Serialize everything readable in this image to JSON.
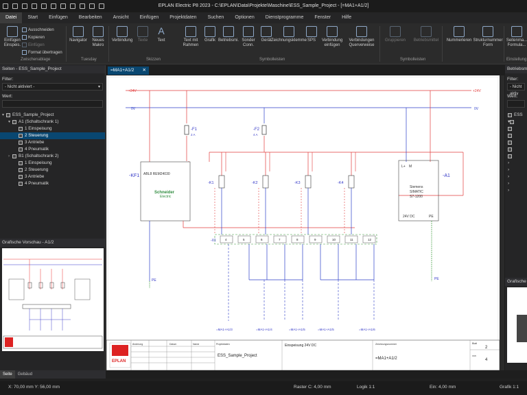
{
  "window": {
    "title": "EPLAN Electric P8 2023 - C:\\EPLAN\\Data\\Projekte\\Maschine\\ESS_Sample_Project - [=MA1+A1/2]"
  },
  "menu": [
    "Datei",
    "Start",
    "Einfügen",
    "Bearbeiten",
    "Ansicht",
    "Einfügen",
    "Projektdaten",
    "Suchen",
    "Optionen",
    "Dienstprogramme",
    "Fenster",
    "Hilfe"
  ],
  "ribbon": {
    "einfuegen": "Einfügen",
    "einfuegen_sub": "Einspeis.",
    "ausschneiden": "Ausschneiden",
    "kopieren": "Kopieren",
    "einfuegen_small": "Einfügen",
    "format": "Format übertragen",
    "navigator": "Navigator",
    "neues": "Neues",
    "makro": "Makro",
    "verbindung": "Verbindung",
    "text": "Text",
    "text_rahmen": "Text mit Rahmen",
    "grafik": "Grafik",
    "betriebsmittel": "Betriebsmi.",
    "sonder": "Sonder Conn.",
    "geraet": "Gerät",
    "klemme": "Zeichnungsklemme",
    "sps": "SPS",
    "verbindung_einfuegen": "Verbindung einfügen",
    "querverweis": "Verbindungen Querverweise",
    "nummerieren": "Nummerieren",
    "struktur": "Strukturnummer Form",
    "seiten": "Seitenma... Formula...",
    "groups": {
      "zwischenablage": "Zwischenablage",
      "tuesday": "Tuesday",
      "skizzen": "Skizzen",
      "symbolleisten": "Symbolleisten",
      "symbolleisten2": "Symbolleisten",
      "einstellung": "Einstellung"
    }
  },
  "leftpanel": {
    "title": "Seiten - ESS_Sample_Project",
    "filter_label": "Filter:",
    "filter_value": "- Nicht aktiviert -",
    "value_label": "Wert:",
    "tree": [
      {
        "label": "ESS_Sample_Project",
        "level": 0,
        "exp": "▾",
        "sel": false
      },
      {
        "label": "A1 (Schaltschrank 1)",
        "level": 1,
        "exp": "▾",
        "sel": false
      },
      {
        "label": "1 Einspeisung",
        "level": 2,
        "exp": "",
        "sel": false
      },
      {
        "label": "2 Steuerung",
        "level": 2,
        "exp": "",
        "sel": true
      },
      {
        "label": "3 Antriebe",
        "level": 2,
        "exp": "",
        "sel": false
      },
      {
        "label": "4 Pneumatik",
        "level": 2,
        "exp": "",
        "sel": false
      },
      {
        "label": "B1 (Schaltschrank 2)",
        "level": 1,
        "exp": "›",
        "sel": false
      },
      {
        "label": "1 Einspeisung",
        "level": 2,
        "exp": "",
        "sel": false
      },
      {
        "label": "2 Steuerung",
        "level": 2,
        "exp": "",
        "sel": false
      },
      {
        "label": "3 Antriebe",
        "level": 2,
        "exp": "",
        "sel": false
      },
      {
        "label": "4 Pneumatik",
        "level": 2,
        "exp": "",
        "sel": false
      }
    ]
  },
  "preview": {
    "title": "Grafische Vorschau - A1/2"
  },
  "doc_tab": {
    "label": "=MA1+A1/2",
    "close": "✕"
  },
  "rightpanel": {
    "title": "Betriebsmittel",
    "filter_label": "Filter:",
    "filter_value": "- Nicht aktiv",
    "value_label": "Wert:",
    "preview_title": "Grafische V"
  },
  "schematic": {
    "rail_top": "+24V",
    "rail_top_right": "+24V",
    "rail_0v": "0V",
    "rail_0v_right": "0V",
    "fuse1": "-F1",
    "fuse1_rating": "2 A",
    "fuse2": "-F2",
    "fuse2_rating": "4 A",
    "kf1": "-KF1",
    "relay_name": "ABL8 REM24030",
    "relay_brand": "Schneider",
    "relay_brand2": "Electric",
    "plc_tag": "-A1",
    "plc_name1": "Siemens",
    "plc_name2": "SIMATIC",
    "plc_name3": "S7-1200",
    "plc_dc": "24V DC",
    "plc_pe": "PE",
    "plc_l": "L+",
    "plc_m": "M",
    "coils": [
      "-K1",
      "-K2",
      "-K3",
      "-K4"
    ],
    "terminal_strip": "-X1",
    "terminals": [
      "1",
      "2",
      "3",
      "4",
      "5",
      "6",
      "7",
      "8",
      "9",
      "10",
      "11",
      "12"
    ],
    "pe_left": "PE",
    "pe_right": "PE",
    "refs": [
      "=MA1+A1/3",
      "=MA1+A1/4",
      "=MA1+A1/5",
      "=MA1+A1/5",
      "=MA1+A1/6"
    ]
  },
  "titleblock": {
    "logo": "EPLAN",
    "col1": "Änderung",
    "col2": "Datum",
    "col3": "Name",
    "project_label": "Projektdaten",
    "project": "ESS_Sample_Project",
    "page_desc": "Einspeisung 24V DC",
    "ident_label": "Zeichnungsnummer",
    "ident": "=MA1+A1/2",
    "sheet_label": "Blatt",
    "sheet": "2",
    "of_label": "von",
    "of": "4"
  },
  "bottomtabs": [
    "Seite",
    "Gebäud"
  ],
  "status": {
    "coords": "X: 70,00 mm  Y: 56,00 mm",
    "raster": "Raster C: 4,00 mm",
    "logik": "Logik 1:1",
    "ein": "Ein: 4,00 mm",
    "grafik": "Grafik 1:1"
  }
}
